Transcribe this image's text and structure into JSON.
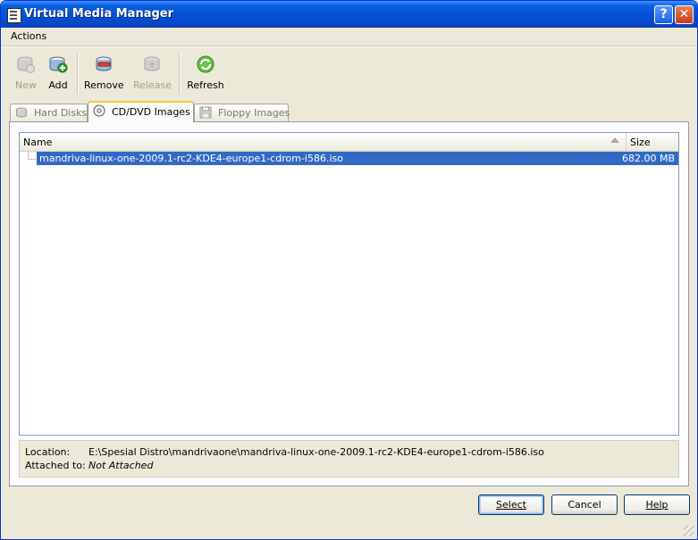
{
  "window": {
    "title": "Virtual Media Manager",
    "help_button": "?",
    "close_button": "✕"
  },
  "menu": {
    "actions": "Actions"
  },
  "toolbar": {
    "new": "New",
    "add": "Add",
    "remove": "Remove",
    "release": "Release",
    "refresh": "Refresh"
  },
  "tabs": {
    "hard_disks": "Hard Disks",
    "cd_dvd": "CD/DVD Images",
    "floppy": "Floppy Images",
    "active": "CD/DVD Images"
  },
  "list": {
    "columns": {
      "name": "Name",
      "size": "Size"
    },
    "rows": [
      {
        "name": "mandriva-linux-one-2009.1-rc2-KDE4-europe1-cdrom-i586.iso",
        "size": "682.00 MB"
      }
    ]
  },
  "info": {
    "location_label": "Location:",
    "location_value": "E:\\Spesial Distro\\mandrivaone\\mandriva-linux-one-2009.1-rc2-KDE4-europe1-cdrom-i586.iso",
    "attached_label": "Attached to:",
    "attached_value": "Not Attached"
  },
  "buttons": {
    "select": "Select",
    "cancel": "Cancel",
    "help": "Help"
  },
  "colors": {
    "title_bar": "#0553d8",
    "selection": "#316ac5",
    "face": "#ece9d8",
    "active_tab_accent": "#ffc73c"
  }
}
